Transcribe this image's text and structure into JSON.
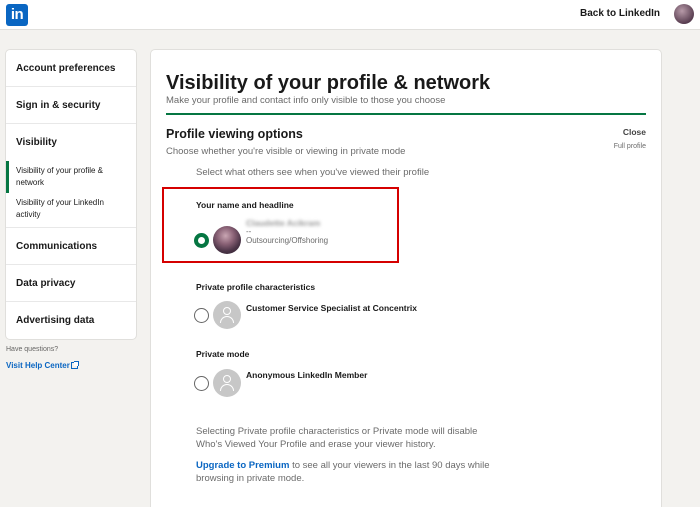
{
  "header": {
    "logo_text": "in",
    "back_link": "Back to LinkedIn"
  },
  "sidebar": {
    "items": [
      {
        "label": "Account preferences"
      },
      {
        "label": "Sign in & security"
      },
      {
        "label": "Visibility"
      },
      {
        "label": "Communications"
      },
      {
        "label": "Data privacy"
      },
      {
        "label": "Advertising data"
      }
    ],
    "subitems": [
      {
        "label": "Visibility of your profile & network",
        "active": true
      },
      {
        "label": "Visibility of your LinkedIn activity",
        "active": false
      }
    ],
    "help_question": "Have questions?",
    "help_link": "Visit Help Center"
  },
  "main": {
    "title": "Visibility of your profile & network",
    "subtitle": "Make your profile and contact info only visible to those you choose",
    "section_title": "Profile viewing options",
    "section_subtitle": "Choose whether you're visible or viewing in private mode",
    "close_label": "Close",
    "close_hint": "Full profile",
    "instruction": "Select what others see when you've viewed their profile",
    "options": [
      {
        "label": "Your name and headline",
        "name": "Claudette Acikram",
        "dash": "--",
        "headline": "Outsourcing/Offshoring",
        "selected": true
      },
      {
        "label": "Private profile characteristics",
        "name": "Customer Service Specialist at Concentrix",
        "selected": false
      },
      {
        "label": "Private mode",
        "name": "Anonymous LinkedIn Member",
        "selected": false
      }
    ],
    "note": "Selecting Private profile characteristics or Private mode will disable Who's Viewed Your Profile and erase your viewer history.",
    "premium_link": "Upgrade to Premium",
    "premium_text": " to see all your viewers in the last 90 days while browsing in private mode."
  },
  "colors": {
    "brand": "#0a66c2",
    "accent_green": "#057642",
    "highlight_red": "#d50000"
  }
}
